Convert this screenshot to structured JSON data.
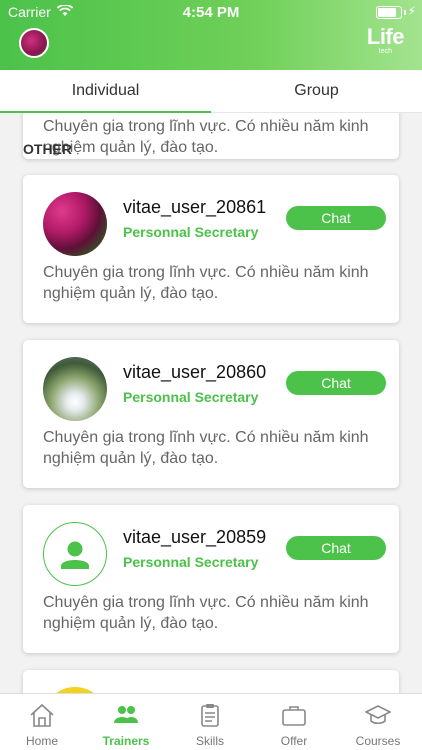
{
  "status_bar": {
    "carrier": "Carrier",
    "time": "4:54 PM",
    "battery_level": 0.9
  },
  "header": {
    "logo_main": "Life",
    "logo_sub": "tech"
  },
  "tabs": [
    {
      "label": "Individual",
      "active": true
    },
    {
      "label": "Group",
      "active": false
    }
  ],
  "section": {
    "title": "OTHER"
  },
  "partial_card": {
    "description": "Chuyên gia trong lĩnh vực. Có nhiều năm kinh nghiệm quản lý, đào tạo."
  },
  "trainers": [
    {
      "name": "vitae_user_20861",
      "role": "Personnal Secretary",
      "chat_label": "Chat",
      "description": "Chuyên gia trong lĩnh vực. Có nhiều năm kinh nghiệm quản lý, đào tạo.",
      "avatar": "flowers-photo"
    },
    {
      "name": "vitae_user_20860",
      "role": "Personnal Secretary",
      "chat_label": "Chat",
      "description": "Chuyên gia trong lĩnh vực. Có nhiều năm kinh nghiệm quản lý, đào tạo.",
      "avatar": "waterfall-photo"
    },
    {
      "name": "vitae_user_20859",
      "role": "Personnal Secretary",
      "chat_label": "Chat",
      "description": "Chuyên gia trong lĩnh vực. Có nhiều năm kinh nghiệm quản lý, đào tạo.",
      "avatar": "person-placeholder-icon"
    }
  ],
  "bottom_nav": [
    {
      "label": "Home",
      "icon": "home-icon",
      "active": false
    },
    {
      "label": "Trainers",
      "icon": "people-icon",
      "active": true
    },
    {
      "label": "Skills",
      "icon": "clipboard-icon",
      "active": false
    },
    {
      "label": "Offer",
      "icon": "briefcase-icon",
      "active": false
    },
    {
      "label": "Courses",
      "icon": "graduation-cap-icon",
      "active": false
    }
  ],
  "colors": {
    "accent": "#4cc24a",
    "header_gradient_end": "#a3e38f",
    "text_muted": "#666666"
  }
}
